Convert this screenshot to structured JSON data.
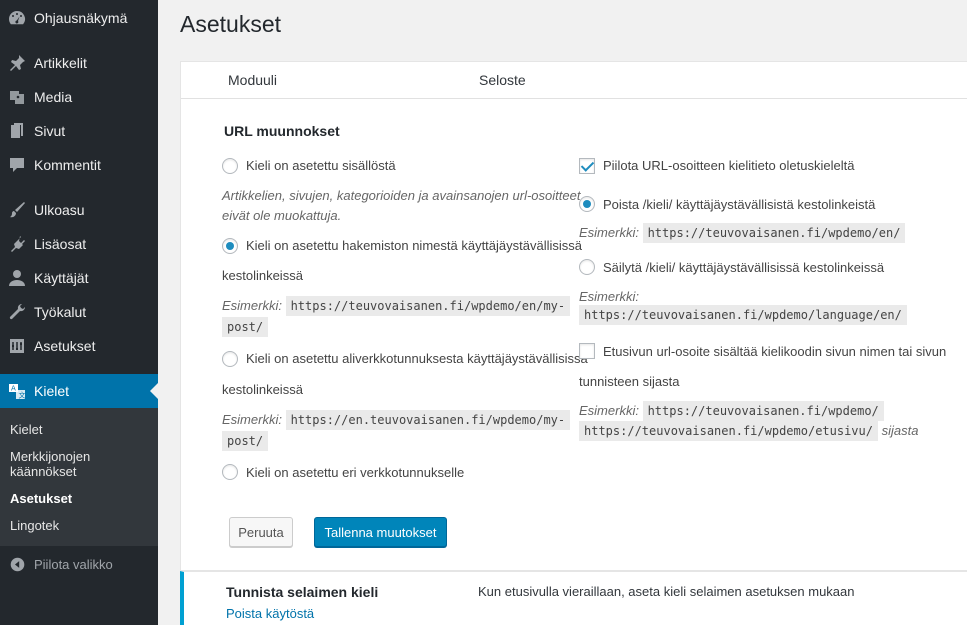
{
  "sidebar": {
    "items": [
      {
        "label": "Ohjausnäkymä",
        "icon": "dashboard-icon"
      },
      {
        "label": "Artikkelit",
        "icon": "pin-icon"
      },
      {
        "label": "Media",
        "icon": "media-icon"
      },
      {
        "label": "Sivut",
        "icon": "pages-icon"
      },
      {
        "label": "Kommentit",
        "icon": "comment-icon"
      },
      {
        "label": "Ulkoasu",
        "icon": "brush-icon"
      },
      {
        "label": "Lisäosat",
        "icon": "plugin-icon"
      },
      {
        "label": "Käyttäjät",
        "icon": "user-icon"
      },
      {
        "label": "Työkalut",
        "icon": "wrench-icon"
      },
      {
        "label": "Asetukset",
        "icon": "settings-icon"
      },
      {
        "label": "Kielet",
        "icon": "translate-icon"
      }
    ],
    "submenu": [
      {
        "label": "Kielet"
      },
      {
        "label": "Merkkijonojen käännökset"
      },
      {
        "label": "Asetukset"
      },
      {
        "label": "Lingotek"
      }
    ],
    "collapse_label": "Piilota valikko"
  },
  "page": {
    "title": "Asetukset"
  },
  "panel": {
    "col_module": "Moduuli",
    "col_description": "Seloste",
    "section_title": "URL muunnokset",
    "left": {
      "opt1": "Kieli on asetettu sisällöstä",
      "opt1_desc_line1": "Artikkelien, sivujen, kategorioiden ja avainsanojen url-osoitteet",
      "opt1_desc_line2": "eivät ole muokattuja.",
      "opt2_line1": "Kieli on asetettu hakemiston nimestä käyttäjäystävällisissä",
      "opt2_line2": "kestolinkeissä",
      "example_label": "Esimerkki:",
      "opt2_code1": "https://teuvovaisanen.fi/wpdemo/en/my-",
      "opt2_code2": "post/",
      "opt3_line1": "Kieli on asetettu aliverkkotunnuksesta käyttäjäystävällisissä",
      "opt3_line2": "kestolinkeissä",
      "opt3_code1": "https://en.teuvovaisanen.fi/wpdemo/my-",
      "opt3_code2": "post/",
      "opt4": "Kieli on asetettu eri verkkotunnukselle"
    },
    "right": {
      "hide_default": "Piilota URL-osoitteen kielitieto oletuskieleltä",
      "remove_lang": "Poista /kieli/ käyttäjäystävällisistä kestolinkeistä",
      "remove_code": "https://teuvovaisanen.fi/wpdemo/en/",
      "keep_lang": "Säilytä /kieli/ käyttäjäystävällisissä kestolinkeissä",
      "keep_code": "https://teuvovaisanen.fi/wpdemo/language/en/",
      "front_line1": "Etusivun url-osoite sisältää kielikoodin sivun nimen tai sivun",
      "front_line2": "tunnisteen sijasta",
      "front_code1": "https://teuvovaisanen.fi/wpdemo/",
      "front_code2": "https://teuvovaisanen.fi/wpdemo/etusivu/",
      "front_suffix": "sijasta",
      "example_label": "Esimerkki:"
    },
    "cancel_label": "Peruuta",
    "save_label": "Tallenna muutokset"
  },
  "module_row": {
    "title": "Tunnista selaimen kieli",
    "action": "Poista käytöstä",
    "description": "Kun etusivulla vieraillaan, aseta kieli selaimen asetuksen mukaan"
  }
}
